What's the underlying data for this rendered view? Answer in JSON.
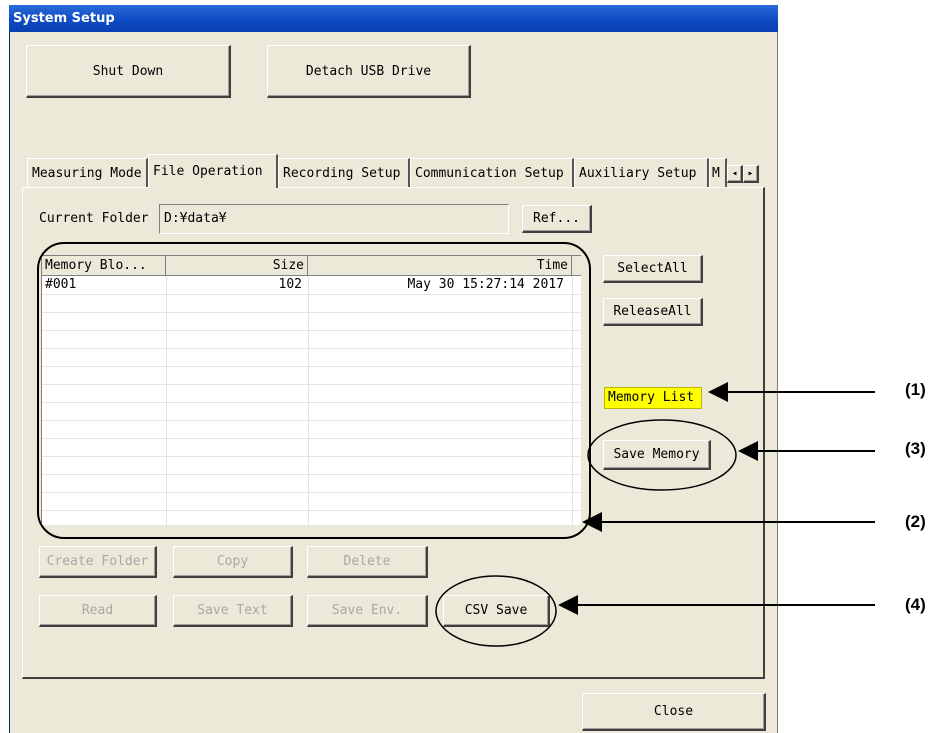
{
  "window": {
    "title": "System Setup"
  },
  "top_buttons": {
    "shut_down": "Shut Down",
    "detach_usb": "Detach USB Drive"
  },
  "tabs": [
    {
      "label": "Measuring Mode"
    },
    {
      "label": "File Operation",
      "active": true
    },
    {
      "label": "Recording Setup"
    },
    {
      "label": "Communication Setup"
    },
    {
      "label": "Auxiliary Setup"
    },
    {
      "label": "M"
    }
  ],
  "tab_scroll": {
    "left": "◂",
    "right": "▸"
  },
  "file_panel": {
    "current_folder_label": "Current Folder",
    "current_folder_value": "D:¥data¥",
    "ref_button": "Ref...",
    "columns": [
      "Memory Blo...",
      "Size",
      "Time"
    ],
    "rows": [
      {
        "block": "#001",
        "size": "102",
        "time": "May 30 15:27:14 2017"
      }
    ],
    "select_all": "SelectAll",
    "release_all": "ReleaseAll",
    "memory_list": "Memory List",
    "save_memory": "Save Memory",
    "create_folder": "Create Folder",
    "copy": "Copy",
    "delete": "Delete",
    "read": "Read",
    "save_text": "Save Text",
    "save_env": "Save Env.",
    "csv_save": "CSV Save"
  },
  "close_button": "Close",
  "callouts": {
    "c1": "(1)",
    "c2": "(2)",
    "c3": "(3)",
    "c4": "(4)"
  }
}
